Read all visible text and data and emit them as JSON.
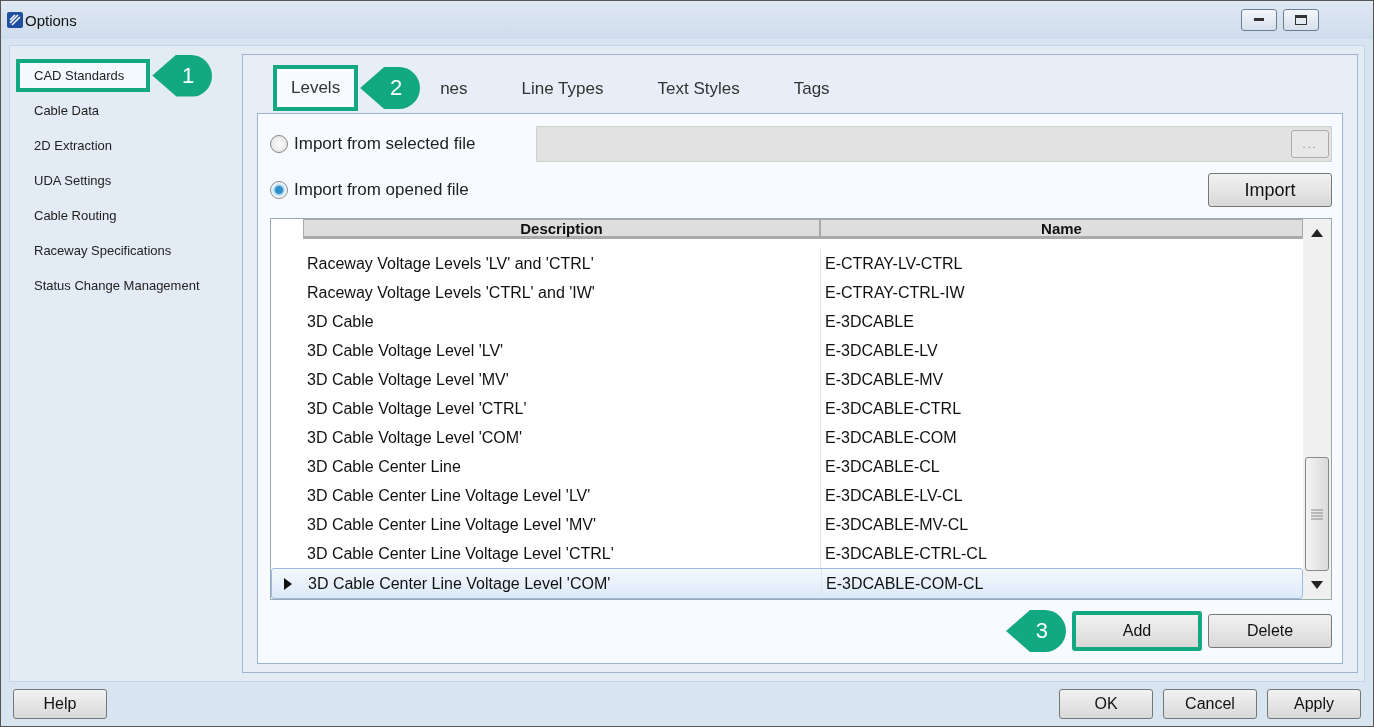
{
  "window": {
    "title": "Options"
  },
  "sidebar": {
    "items": [
      {
        "label": "CAD Standards",
        "selected": true,
        "highlighted": true,
        "callout": "1"
      },
      {
        "label": "Cable Data",
        "selected": false,
        "highlighted": false
      },
      {
        "label": "2D Extraction",
        "selected": false,
        "highlighted": false
      },
      {
        "label": "UDA Settings",
        "selected": false,
        "highlighted": false
      },
      {
        "label": "Cable Routing",
        "selected": false,
        "highlighted": false
      },
      {
        "label": "Raceway Specifications",
        "selected": false,
        "highlighted": false
      },
      {
        "label": "Status Change Management",
        "selected": false,
        "highlighted": false
      }
    ]
  },
  "tabs": [
    {
      "label": "Levels",
      "selected": true,
      "highlighted": true,
      "callout": "2"
    },
    {
      "label": "nes",
      "selected": false,
      "highlighted": false
    },
    {
      "label": "Line Types",
      "selected": false,
      "highlighted": false
    },
    {
      "label": "Text Styles",
      "selected": false,
      "highlighted": false
    },
    {
      "label": "Tags",
      "selected": false,
      "highlighted": false
    }
  ],
  "import_options": [
    {
      "label": "Import from selected file",
      "selected": false
    },
    {
      "label": "Import from opened file",
      "selected": true
    }
  ],
  "browse_button": "...",
  "import_button": "Import",
  "table": {
    "columns": [
      "Description",
      "Name"
    ],
    "rows": [
      {
        "description": "Raceway Voltage Levels 'LV' and 'CTRL'",
        "name": "E-CTRAY-LV-CTRL",
        "selected": false
      },
      {
        "description": "Raceway Voltage Levels 'CTRL' and 'IW'",
        "name": "E-CTRAY-CTRL-IW",
        "selected": false
      },
      {
        "description": "3D Cable",
        "name": "E-3DCABLE",
        "selected": false
      },
      {
        "description": "3D Cable Voltage Level 'LV'",
        "name": "E-3DCABLE-LV",
        "selected": false
      },
      {
        "description": "3D Cable Voltage Level 'MV'",
        "name": "E-3DCABLE-MV",
        "selected": false
      },
      {
        "description": "3D Cable Voltage Level 'CTRL'",
        "name": "E-3DCABLE-CTRL",
        "selected": false
      },
      {
        "description": "3D Cable Voltage Level 'COM'",
        "name": "E-3DCABLE-COM",
        "selected": false
      },
      {
        "description": "3D Cable Center Line",
        "name": "E-3DCABLE-CL",
        "selected": false
      },
      {
        "description": "3D Cable Center Line Voltage Level 'LV'",
        "name": "E-3DCABLE-LV-CL",
        "selected": false
      },
      {
        "description": "3D Cable Center Line Voltage Level 'MV'",
        "name": "E-3DCABLE-MV-CL",
        "selected": false
      },
      {
        "description": "3D Cable Center Line Voltage Level 'CTRL'",
        "name": "E-3DCABLE-CTRL-CL",
        "selected": false
      },
      {
        "description": "3D Cable Center Line Voltage Level 'COM'",
        "name": "E-3DCABLE-COM-CL",
        "selected": true
      }
    ]
  },
  "table_buttons": [
    {
      "label": "Add",
      "highlighted": true,
      "callout": "3"
    },
    {
      "label": "Delete",
      "highlighted": false
    }
  ],
  "footer": {
    "left": [
      "Help"
    ],
    "right": [
      "OK",
      "Cancel",
      "Apply"
    ]
  }
}
